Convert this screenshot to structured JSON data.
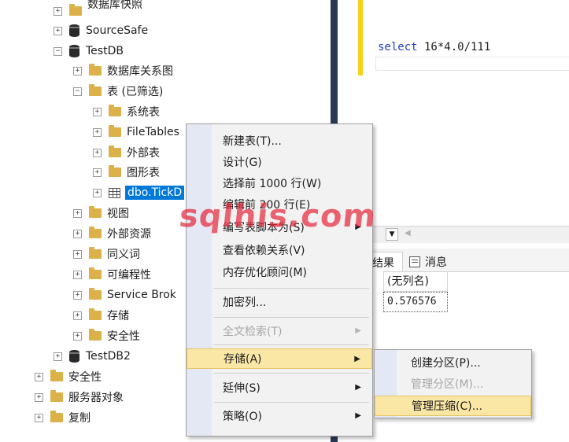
{
  "tree": {
    "items": [
      {
        "label": "数据库快照",
        "icon": "folder-icon",
        "expander": "+",
        "depth": 2
      },
      {
        "label": "SourceSafe",
        "icon": "database-icon",
        "expander": "+",
        "depth": 2
      },
      {
        "label": "TestDB",
        "icon": "database-icon",
        "expander": "−",
        "depth": 2
      },
      {
        "label": "数据库关系图",
        "icon": "folder-icon",
        "expander": "+",
        "depth": 3
      },
      {
        "label": "表 (已筛选)",
        "icon": "folder-icon",
        "expander": "−",
        "depth": 3
      },
      {
        "label": "系统表",
        "icon": "folder-icon",
        "expander": "+",
        "depth": 4
      },
      {
        "label": "FileTables",
        "icon": "folder-icon",
        "expander": "+",
        "depth": 4
      },
      {
        "label": "外部表",
        "icon": "folder-icon",
        "expander": "+",
        "depth": 4
      },
      {
        "label": "图形表",
        "icon": "folder-icon",
        "expander": "+",
        "depth": 4
      },
      {
        "label": "dbo.TickD",
        "icon": "table-icon",
        "expander": "+",
        "depth": 4,
        "selected": true
      },
      {
        "label": "视图",
        "icon": "folder-icon",
        "expander": "+",
        "depth": 3
      },
      {
        "label": "外部资源",
        "icon": "folder-icon",
        "expander": "+",
        "depth": 3
      },
      {
        "label": "同义词",
        "icon": "folder-icon",
        "expander": "+",
        "depth": 3
      },
      {
        "label": "可编程性",
        "icon": "folder-icon",
        "expander": "+",
        "depth": 3
      },
      {
        "label": "Service Brok",
        "icon": "folder-icon",
        "expander": "+",
        "depth": 3
      },
      {
        "label": "存储",
        "icon": "folder-icon",
        "expander": "+",
        "depth": 3
      },
      {
        "label": "安全性",
        "icon": "folder-icon",
        "expander": "+",
        "depth": 3
      },
      {
        "label": "TestDB2",
        "icon": "database-icon",
        "expander": "+",
        "depth": 2
      },
      {
        "label": "安全性",
        "icon": "folder-icon",
        "expander": "+",
        "depth": 1
      },
      {
        "label": "服务器对象",
        "icon": "folder-icon",
        "expander": "+",
        "depth": 1
      },
      {
        "label": "复制",
        "icon": "folder-icon",
        "expander": "+",
        "depth": 1
      }
    ]
  },
  "editor": {
    "keyword": "select",
    "expression": " 16*4.0/111"
  },
  "results": {
    "tab_results": "结果",
    "tab_messages": "消息",
    "column_header": "(无列名)",
    "cell_value": "0.576576"
  },
  "context_menu": {
    "items": [
      {
        "label": "新建表(T)...",
        "enabled": true,
        "submenu": false
      },
      {
        "label": "设计(G)",
        "enabled": true,
        "submenu": false
      },
      {
        "label": "选择前 1000 行(W)",
        "enabled": true,
        "submenu": false
      },
      {
        "label": "编辑前 200 行(E)",
        "enabled": true,
        "submenu": false
      },
      {
        "label": "编写表脚本为(S)",
        "enabled": true,
        "submenu": true
      },
      {
        "label": "查看依赖关系(V)",
        "enabled": true,
        "submenu": false
      },
      {
        "label": "内存优化顾问(M)",
        "enabled": true,
        "submenu": false
      },
      {
        "label": "加密列...",
        "enabled": true,
        "submenu": false
      },
      {
        "label": "全文检索(T)",
        "enabled": false,
        "submenu": true
      },
      {
        "label": "存储(A)",
        "enabled": true,
        "submenu": true,
        "highlighted": true
      },
      {
        "label": "延伸(S)",
        "enabled": true,
        "submenu": true
      },
      {
        "label": "策略(O)",
        "enabled": true,
        "submenu": true
      }
    ]
  },
  "storage_submenu": {
    "items": [
      {
        "label": "创建分区(P)...",
        "enabled": true
      },
      {
        "label": "管理分区(M)...",
        "enabled": false
      },
      {
        "label": "管理压缩(C)...",
        "enabled": true,
        "highlighted": true
      }
    ]
  },
  "watermark": "sqlhis.com",
  "colors": {
    "selection": "#0078d7",
    "menu_highlight": "#fbe7a5",
    "folder": "#dcb14a",
    "dark_divider": "#293955",
    "editor_marker": "#f7d21a",
    "keyword": "#1f3fbf",
    "watermark": "#e6283c"
  }
}
